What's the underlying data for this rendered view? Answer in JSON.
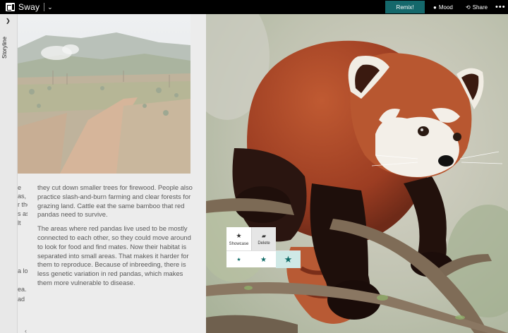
{
  "app": {
    "title": "Sway",
    "remix_label": "Remix!",
    "mood_label": "Mood",
    "share_label": "Share",
    "more_label": "•••"
  },
  "storyline": {
    "label": "Storyline"
  },
  "left_fragments": [
    "e",
    "as,",
    "r the",
    "s as",
    "lt",
    "a lot",
    "ea.",
    "ad"
  ],
  "body": {
    "p1": "they cut down smaller trees for firewood. People also practice slash-and-burn farming and clear forests for grazing land. Cattle eat the same bamboo that red pandas need to survive.",
    "p2": "The areas where red pandas live used to be mostly connected to each other, so they could move around to look for food and find mates. Now their habitat is separated into small areas. That makes it harder for them to reproduce. Because of inbreeding, there is less genetic variation in red pandas, which makes them more vulnerable to disease."
  },
  "popup": {
    "showcase_label": "Showcase",
    "delete_label": "Delete"
  },
  "icons": {
    "star": "★",
    "trash": "🗑",
    "chevron_right": "›",
    "chevron_down": "⌄",
    "back": "‹"
  },
  "colors": {
    "accent": "#14686b",
    "emphasis": "#0f6a66"
  }
}
